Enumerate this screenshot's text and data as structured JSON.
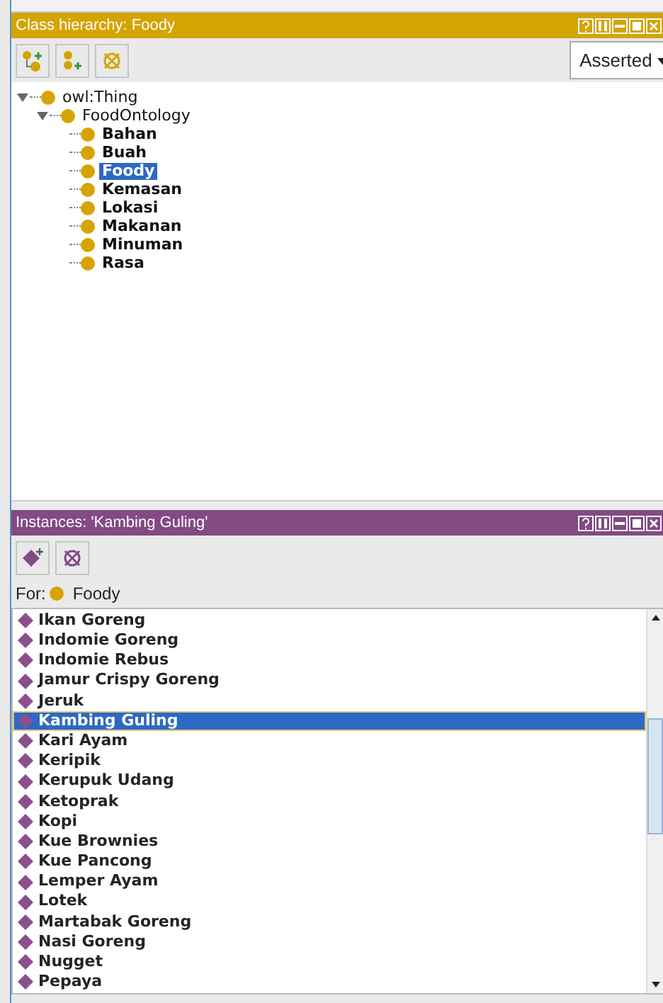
{
  "class_panel": {
    "title": "Class hierarchy: Foody",
    "view_select": "Asserted",
    "tree": [
      {
        "label": "owl:Thing",
        "expanded": true,
        "bold": false,
        "selected": false,
        "children": [
          {
            "label": "FoodOntology",
            "expanded": true,
            "bold": false,
            "selected": false,
            "children": [
              {
                "label": "Bahan",
                "bold": true,
                "selected": false
              },
              {
                "label": "Buah",
                "bold": true,
                "selected": false
              },
              {
                "label": "Foody",
                "bold": true,
                "selected": true
              },
              {
                "label": "Kemasan",
                "bold": true,
                "selected": false
              },
              {
                "label": "Lokasi",
                "bold": true,
                "selected": false
              },
              {
                "label": "Makanan",
                "bold": true,
                "selected": false
              },
              {
                "label": "Minuman",
                "bold": true,
                "selected": false
              },
              {
                "label": "Rasa",
                "bold": true,
                "selected": false
              }
            ]
          }
        ]
      }
    ]
  },
  "instances_panel": {
    "title": "Instances: 'Kambing Guling'",
    "for_label": "For:",
    "for_class": "Foody",
    "items": [
      {
        "label": "Ikan Goreng",
        "selected": false
      },
      {
        "label": "Indomie Goreng",
        "selected": false
      },
      {
        "label": "Indomie Rebus",
        "selected": false
      },
      {
        "label": "Jamur Crispy Goreng",
        "selected": false
      },
      {
        "label": "Jeruk",
        "selected": false
      },
      {
        "label": "Kambing Guling",
        "selected": true
      },
      {
        "label": "Kari Ayam",
        "selected": false
      },
      {
        "label": "Keripik",
        "selected": false
      },
      {
        "label": "Kerupuk Udang",
        "selected": false
      },
      {
        "label": "Ketoprak",
        "selected": false
      },
      {
        "label": "Kopi",
        "selected": false
      },
      {
        "label": "Kue Brownies",
        "selected": false
      },
      {
        "label": "Kue Pancong",
        "selected": false
      },
      {
        "label": "Lemper Ayam",
        "selected": false
      },
      {
        "label": "Lotek",
        "selected": false
      },
      {
        "label": "Martabak Goreng",
        "selected": false
      },
      {
        "label": "Nasi Goreng",
        "selected": false
      },
      {
        "label": "Nugget",
        "selected": false
      },
      {
        "label": "Pepaya",
        "selected": false
      }
    ]
  }
}
